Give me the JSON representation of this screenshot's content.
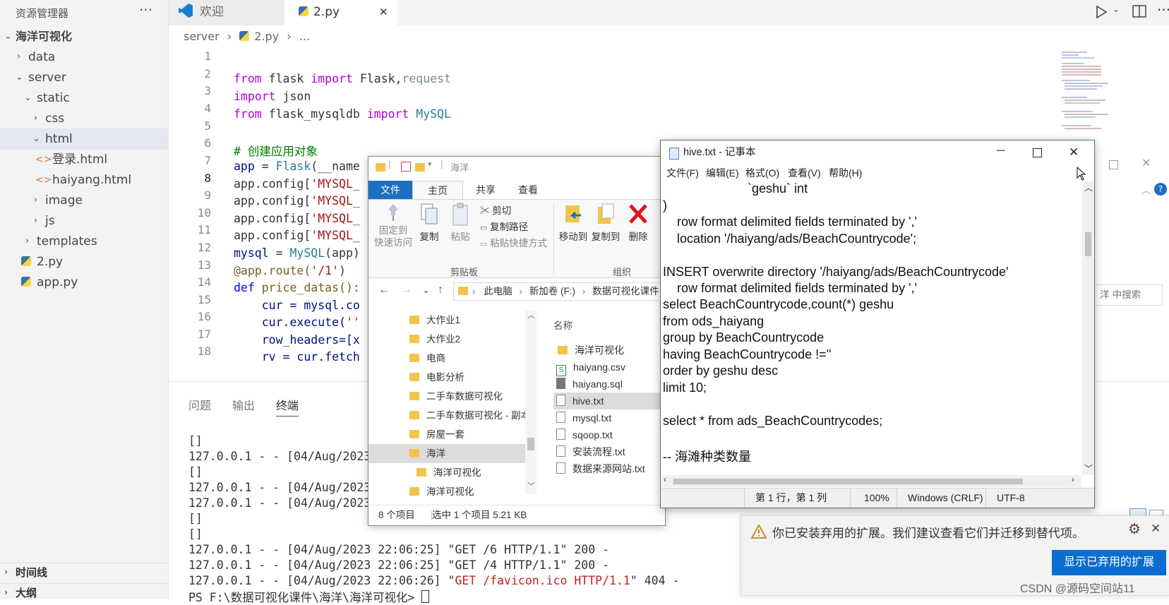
{
  "sidebar": {
    "title": "资源管理器",
    "more": "···",
    "root": "海洋可视化",
    "items": [
      {
        "label": "data"
      },
      {
        "label": "server"
      },
      {
        "label": "static"
      },
      {
        "label": "css"
      },
      {
        "label": "html"
      },
      {
        "label": "登录.html"
      },
      {
        "label": "haiyang.html"
      },
      {
        "label": "image"
      },
      {
        "label": "js"
      },
      {
        "label": "templates"
      },
      {
        "label": "2.py"
      },
      {
        "label": "app.py"
      }
    ],
    "timeline": "时间线",
    "outline": "大纲"
  },
  "tabs": {
    "welcome": "欢迎",
    "file": "2.py",
    "close": "✕"
  },
  "breadcrumb": {
    "folder": "server",
    "sep": "›",
    "file": "2.py",
    "more": "..."
  },
  "editor": {
    "line_numbers": [
      "1",
      "2",
      "3",
      "4",
      "5",
      "6",
      "7",
      "8",
      "9",
      "10",
      "11",
      "12",
      "13",
      "14",
      "15",
      "16",
      "17",
      "18"
    ],
    "lines": {
      "l2a": "from",
      "l2b": " flask ",
      "l2c": "import",
      "l2d": " Flask,",
      "l2e": "request",
      "l3a": "import",
      "l3b": " json",
      "l4a": "from",
      "l4b": " flask_mysqldb ",
      "l4c": "import",
      "l4d": " MySQL",
      "l6": "# 创建应用对象",
      "l7a": "app",
      "l7b": " = ",
      "l7c": "Flask",
      "l7d": "(__name",
      "l8a": "app.config[",
      "l8b": "'MYSQL_",
      "l9a": "app.config[",
      "l9b": "'MYSQL_",
      "l10a": "app.config[",
      "l10b": "'MYSQL_",
      "l11a": "app.config[",
      "l11b": "'MYSQL_",
      "l12a": "mysql",
      "l12b": " = ",
      "l12c": "MySQL",
      "l12d": "(app)",
      "l13a": "@app.route(",
      "l13b": "'/1'",
      "l13c": ")",
      "l14a": "def",
      "l14b": " price_datas():",
      "l15": "    cur = mysql.co",
      "l16a": "    cur.execute(",
      "l16b": "''",
      "l17": "    row_headers=[x",
      "l18": "    rv = cur.fetch"
    }
  },
  "panel": {
    "tabs": [
      "问题",
      "输出",
      "终端"
    ],
    "terminal": [
      "[]",
      "127.0.0.1 - - [04/Aug/2023",
      "[]",
      "127.0.0.1 - - [04/Aug/2023",
      "127.0.0.1 - - [04/Aug/2023",
      "[]",
      "[]",
      "127.0.0.1 - - [04/Aug/2023 22:06:25] \"GET /6 HTTP/1.1\" 200 -",
      "127.0.0.1 - - [04/Aug/2023 22:06:25] \"GET /4 HTTP/1.1\" 200 -",
      "127.0.0.1 - - [04/Aug/2023 22:06:26] \"",
      "PS F:\\数据可视化课件\\海洋\\海洋可视化> "
    ],
    "t10_red": "GET /favicon.ico HTTP/1.1",
    "t10_end": "\" 404 -"
  },
  "explorer": {
    "title": "海洋",
    "ribbon_tabs": [
      "文件",
      "主页",
      "共享",
      "查看"
    ],
    "buttons": {
      "pin": "固定到\n快速访问",
      "copy": "复制",
      "paste": "粘贴",
      "cut": "剪切",
      "copy_path": "复制路径",
      "paste_shortcut": "粘贴快捷方式",
      "move_to": "移动到",
      "copy_to": "复制到",
      "delete": "删除"
    },
    "groups": {
      "clipboard": "剪贴板",
      "organize": "组织"
    },
    "address": [
      "此电脑",
      "新加卷 (F:)",
      "数据可视化课件"
    ],
    "nav_items": [
      "大作业1",
      "大作业2",
      "电商",
      "电影分析",
      "二手车数据可视化",
      "二手车数据可视化 - 副本",
      "房屋一套",
      "海洋",
      "海洋可视化",
      "海洋可视化"
    ],
    "column_name": "名称",
    "files": [
      "海洋可视化",
      "haiyang.csv",
      "haiyang.sql",
      "hive.txt",
      "mysql.txt",
      "sqoop.txt",
      "安装流程.txt",
      "数据来源网站.txt"
    ],
    "status_count": "8 个项目",
    "status_selected": "选中 1 个项目  5.21 KB",
    "search_hint": "洋 中搜索"
  },
  "notepad": {
    "title": "hive.txt - 记事本",
    "menu": [
      "文件(F)",
      "编辑(E)",
      "格式(O)",
      "查看(V)",
      "帮助(H)"
    ],
    "lines": [
      "                        `geshu` int",
      ")",
      "    row format delimited fields terminated by ','",
      "    location '/haiyang/ads/BeachCountrycode';",
      "",
      "INSERT overwrite directory '/haiyang/ads/BeachCountrycode'",
      "    row format delimited fields terminated by ','",
      "select BeachCountrycode,count(*) geshu",
      "from ods_haiyang",
      "group by BeachCountrycode",
      "having BeachCountrycode !=''",
      "order by geshu desc",
      "limit 10;",
      "",
      "select * from ads_BeachCountrycodes;",
      "",
      "-- 海滩种类数量"
    ],
    "status": {
      "position": "第 1 行，第 1 列",
      "zoom": "100%",
      "eol": "Windows (CRLF)",
      "encoding": "UTF-8"
    }
  },
  "notification": {
    "message": "你已安装弃用的扩展。我们建议查看它们并迁移到替代项。",
    "button": "显示已弃用的扩展"
  },
  "watermark": "CSDN @源码空间站11"
}
